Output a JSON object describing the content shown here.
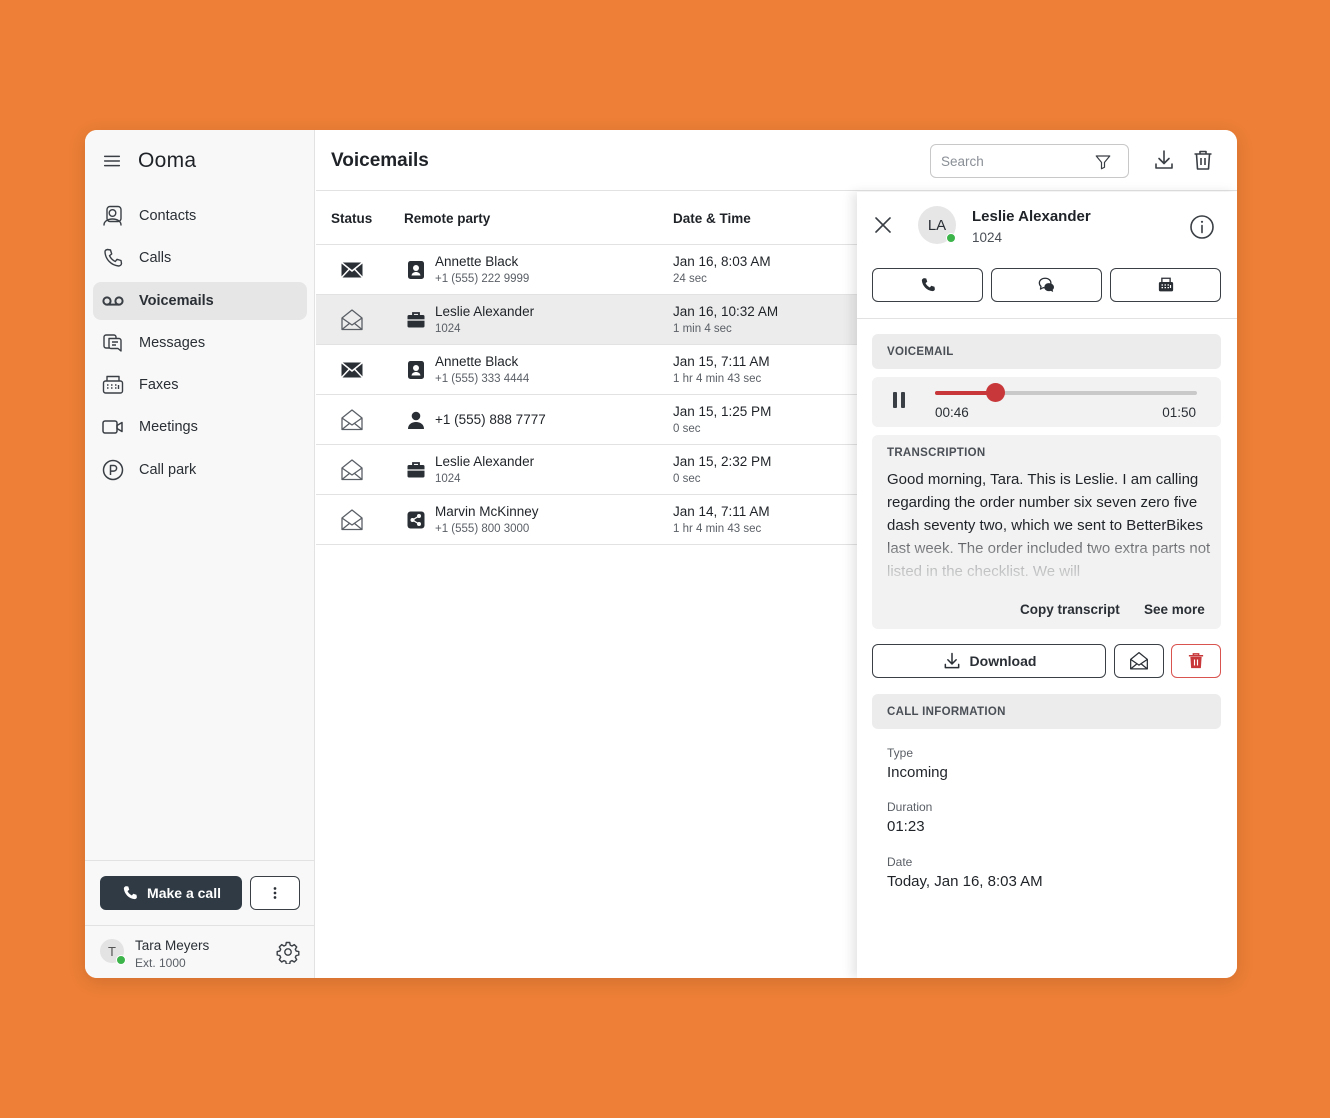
{
  "app": {
    "logo": "Ooma"
  },
  "sidebar": {
    "items": [
      {
        "label": "Contacts",
        "icon": "contacts-icon"
      },
      {
        "label": "Calls",
        "icon": "phone-icon"
      },
      {
        "label": "Voicemails",
        "icon": "voicemail-icon",
        "active": true
      },
      {
        "label": "Messages",
        "icon": "messages-icon"
      },
      {
        "label": "Faxes",
        "icon": "fax-icon"
      },
      {
        "label": "Meetings",
        "icon": "video-icon"
      },
      {
        "label": "Call park",
        "icon": "parking-icon"
      }
    ],
    "make_call_label": "Make a call",
    "user": {
      "initial": "T",
      "name": "Tara Meyers",
      "ext": "Ext. 1000",
      "status": "online"
    }
  },
  "header": {
    "title": "Voicemails",
    "search_placeholder": "Search"
  },
  "list": {
    "columns": [
      "Status",
      "Remote party",
      "Date & Time"
    ],
    "rows": [
      {
        "status": "unread",
        "type": "contact",
        "name": "Annette Black",
        "sub": "+1 (555) 222 9999",
        "datetime": "Jan 16, 8:03 AM",
        "duration": "24 sec"
      },
      {
        "status": "read",
        "type": "coworker",
        "name": "Leslie Alexander",
        "sub": "1024",
        "datetime": "Jan 16, 10:32 AM",
        "duration": "1 min 4 sec",
        "selected": true
      },
      {
        "status": "unread",
        "type": "contact",
        "name": "Annette Black",
        "sub": "+1 (555) 333 4444",
        "datetime": "Jan 15, 7:11 AM",
        "duration": "1 hr 4 min 43 sec"
      },
      {
        "status": "read",
        "type": "person",
        "name": "+1 (555) 888 7777",
        "sub": "",
        "datetime": "Jan 15, 1:25 PM",
        "duration": "0 sec"
      },
      {
        "status": "read",
        "type": "coworker",
        "name": "Leslie Alexander",
        "sub": "1024",
        "datetime": "Jan 15, 2:32 PM",
        "duration": "0 sec"
      },
      {
        "status": "read",
        "type": "shared",
        "name": "Marvin McKinney",
        "sub": "+1 (555) 800 3000",
        "datetime": "Jan 14, 7:11 AM",
        "duration": "1 hr 4 min 43 sec"
      }
    ]
  },
  "detail": {
    "initials": "LA",
    "name": "Leslie Alexander",
    "ext": "1024",
    "status": "online",
    "voicemail_heading": "VOICEMAIL",
    "player": {
      "current": "00:46",
      "total": "01:50",
      "progress": 0.23
    },
    "transcription_heading": "TRANSCRIPTION",
    "transcription": "Good morning, Tara. This is Leslie. I am calling regarding the order number six seven zero five dash seventy two, which we sent to BetterBikes last week. The order included two extra parts not listed in the checklist. We will",
    "copy_label": "Copy transcript",
    "see_more_label": "See more",
    "download_label": "Download",
    "call_info_heading": "CALL INFORMATION",
    "fields": [
      {
        "label": "Type",
        "value": "Incoming"
      },
      {
        "label": "Duration",
        "value": "01:23"
      },
      {
        "label": "Date",
        "value": "Today, Jan 16, 8:03 AM"
      }
    ]
  },
  "colors": {
    "background": "#ED7F36",
    "accent": "#c8383a",
    "primary_button": "#2f3a44",
    "online": "#3cb44a"
  }
}
